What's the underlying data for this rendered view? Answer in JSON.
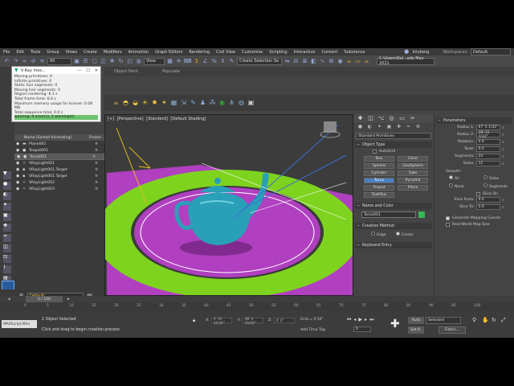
{
  "menu": {
    "items": [
      "File",
      "Edit",
      "Tools",
      "Group",
      "Views",
      "Create",
      "Modifiers",
      "Animation",
      "Graph Editors",
      "Rendering",
      "Civil View",
      "Customize",
      "Scripting",
      "Interactive",
      "Content",
      "Substance"
    ],
    "user": "kiryberg",
    "workspaces_label": "Workspaces:",
    "workspace_value": "Default"
  },
  "toolbar": {
    "filter_value": "All",
    "view_value": "View",
    "selection_set": "Create Selection Se",
    "path": "C:\\Users\\Kol...ads Max 2021"
  },
  "ribbon": {
    "tabs": [
      "Object Paint",
      "Populate"
    ]
  },
  "vray_window": {
    "title": "V-Ray mes...",
    "lines": [
      "Moving primitives: 0",
      "Infinite primitives: 0",
      "Static hair segments: 0",
      "Moving hair segments: 0",
      "Region rendering: 6.1 s",
      "Total frame time: 6.6 s",
      "Maximum memory usage for license: 0.08 MB",
      "Total sequence time: 0.0 s",
      "warning: 0 error(s), 1 warning(s)"
    ]
  },
  "scene_explorer": {
    "header": "Name (Sorted Ascending)",
    "frozen_label": "Frozen",
    "rows": [
      {
        "name": "Plane001",
        "selected": false
      },
      {
        "name": "Teapot001",
        "selected": false
      },
      {
        "name": "Torus001",
        "selected": true
      },
      {
        "name": "VRayLight001",
        "selected": false
      },
      {
        "name": "VRayLight001.Target",
        "selected": false
      },
      {
        "name": "VRayLight001.Target",
        "selected": false
      },
      {
        "name": "VRayLight002",
        "selected": false
      },
      {
        "name": "VRayLight003",
        "selected": false
      }
    ]
  },
  "layer": {
    "value": "Default"
  },
  "viewport": {
    "labels": [
      "[+]",
      "[Perspective]",
      "[Standard]",
      "[Default Shading]"
    ]
  },
  "command_panel": {
    "category": "Standard Primitives",
    "object_type_title": "Object Type",
    "autogrid": "AutoGrid",
    "buttons": [
      {
        "label": "Box",
        "active": false
      },
      {
        "label": "Cone",
        "active": false
      },
      {
        "label": "Sphere",
        "active": false
      },
      {
        "label": "GeoSphere",
        "active": false
      },
      {
        "label": "Cylinder",
        "active": false
      },
      {
        "label": "Tube",
        "active": false
      },
      {
        "label": "Torus",
        "active": true
      },
      {
        "label": "Pyramid",
        "active": false
      },
      {
        "label": "Teapot",
        "active": false
      },
      {
        "label": "Plane",
        "active": false
      },
      {
        "label": "TextPlus",
        "active": false
      }
    ],
    "name_color_title": "Name and Color",
    "object_name": "Torus001",
    "color": "#33b855",
    "creation_method_title": "Creation Method",
    "creation_edge": "Edge",
    "creation_center": "Center",
    "keyboard_entry_title": "Keyboard Entry"
  },
  "parameters": {
    "title": "Parameters",
    "fields": [
      {
        "label": "Radius 1:",
        "value": "67' 5 1/32\""
      },
      {
        "label": "Radius 2:",
        "value": "19' 11 7/32\""
      },
      {
        "label": "Rotation:",
        "value": "0.0"
      },
      {
        "label": "Twist:",
        "value": "0.0"
      },
      {
        "label": "Segments:",
        "value": "24"
      },
      {
        "label": "Sides:",
        "value": "12"
      }
    ],
    "smooth_label": "Smooth:",
    "smooth_opts": [
      "All",
      "Sides",
      "None",
      "Segments"
    ],
    "slice_on": "Slice On",
    "slice_from_label": "Slice From:",
    "slice_from": "0.0",
    "slice_to_label": "Slice To:",
    "slice_to": "0.0",
    "gen_mapping": "Generate Mapping Coords.",
    "real_world": "Real-World Map Size"
  },
  "timeline": {
    "handle": "0 / 100",
    "ticks": [
      "0",
      "5",
      "10",
      "15",
      "20",
      "25",
      "30",
      "35",
      "40",
      "45",
      "50",
      "55",
      "60",
      "65",
      "70",
      "75",
      "80",
      "85",
      "90",
      "95",
      "100"
    ]
  },
  "status": {
    "maxscript": "MAXScript Mini",
    "selected": "1 Object Selected",
    "prompt": "Click and drag to begin creation process",
    "x_label": "X:",
    "x_value": "4' 10 15/32\"",
    "y_label": "Y:",
    "y_value": "48' 4 15/32\"",
    "z_label": "Z:",
    "z_value": "0' 0\"",
    "grid": "Grid = 0'10\"",
    "add_time_tag": "Add Time Tag",
    "frame": "0",
    "auto_key": "Auto",
    "set_key": "Set K.",
    "selected_dropdown": "Selected",
    "filters": "Filters..."
  }
}
